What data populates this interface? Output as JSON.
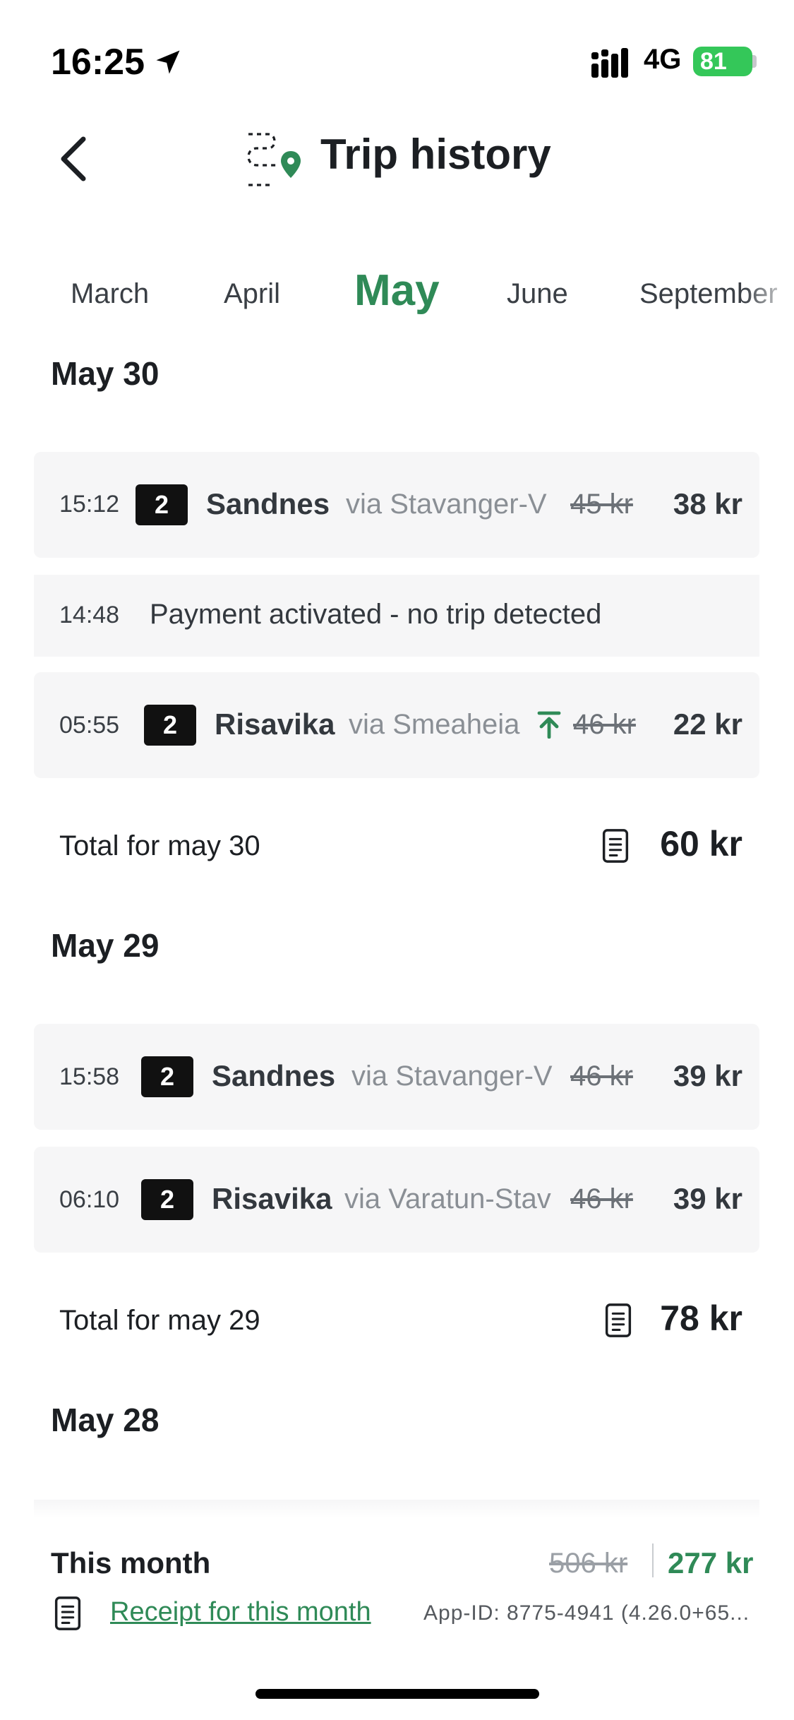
{
  "status_bar": {
    "time": "16:25",
    "network": "4G",
    "battery": "81"
  },
  "header": {
    "title": "Trip history",
    "back_icon": "chevron-left-icon",
    "trip_icon": "route-pin-icon"
  },
  "months": [
    {
      "label": "March",
      "active": false
    },
    {
      "label": "April",
      "active": false
    },
    {
      "label": "May",
      "active": true
    },
    {
      "label": "June",
      "active": false
    },
    {
      "label": "September",
      "active": false
    }
  ],
  "days": [
    {
      "heading": "May 30",
      "items": [
        {
          "time": "15:12",
          "line": "2",
          "destination": "Sandnes",
          "via": "via Stavanger-V",
          "old_price": "45 kr",
          "price": "38 kr"
        },
        {
          "time": "14:48",
          "message": "Payment activated - no trip detected"
        },
        {
          "time": "05:55",
          "line": "2",
          "destination": "Risavika",
          "via": "via Smeaheia",
          "old_price": "46 kr",
          "price": "22 kr"
        }
      ],
      "total_label": "Total for may 30",
      "total": "60 kr"
    },
    {
      "heading": "May 29",
      "items": [
        {
          "time": "15:58",
          "line": "2",
          "destination": "Sandnes",
          "via": "via Stavanger-V",
          "old_price": "46 kr",
          "price": "39 kr"
        },
        {
          "time": "06:10",
          "line": "2",
          "destination": "Risavika",
          "via": "via Varatun-Stav",
          "old_price": "46 kr",
          "price": "39 kr"
        }
      ],
      "total_label": "Total for may 29",
      "total": "78 kr"
    },
    {
      "heading": "May 28"
    }
  ],
  "footer": {
    "label": "This month",
    "old_total": "506 kr",
    "total": "277 kr",
    "receipt_link": "Receipt for this month",
    "app_id": "App-ID: 8775-4941 (4.26.0+65..."
  },
  "colors": {
    "accent": "#2f8a57",
    "card_bg": "#f6f6f7",
    "badge_bg": "#111111"
  }
}
